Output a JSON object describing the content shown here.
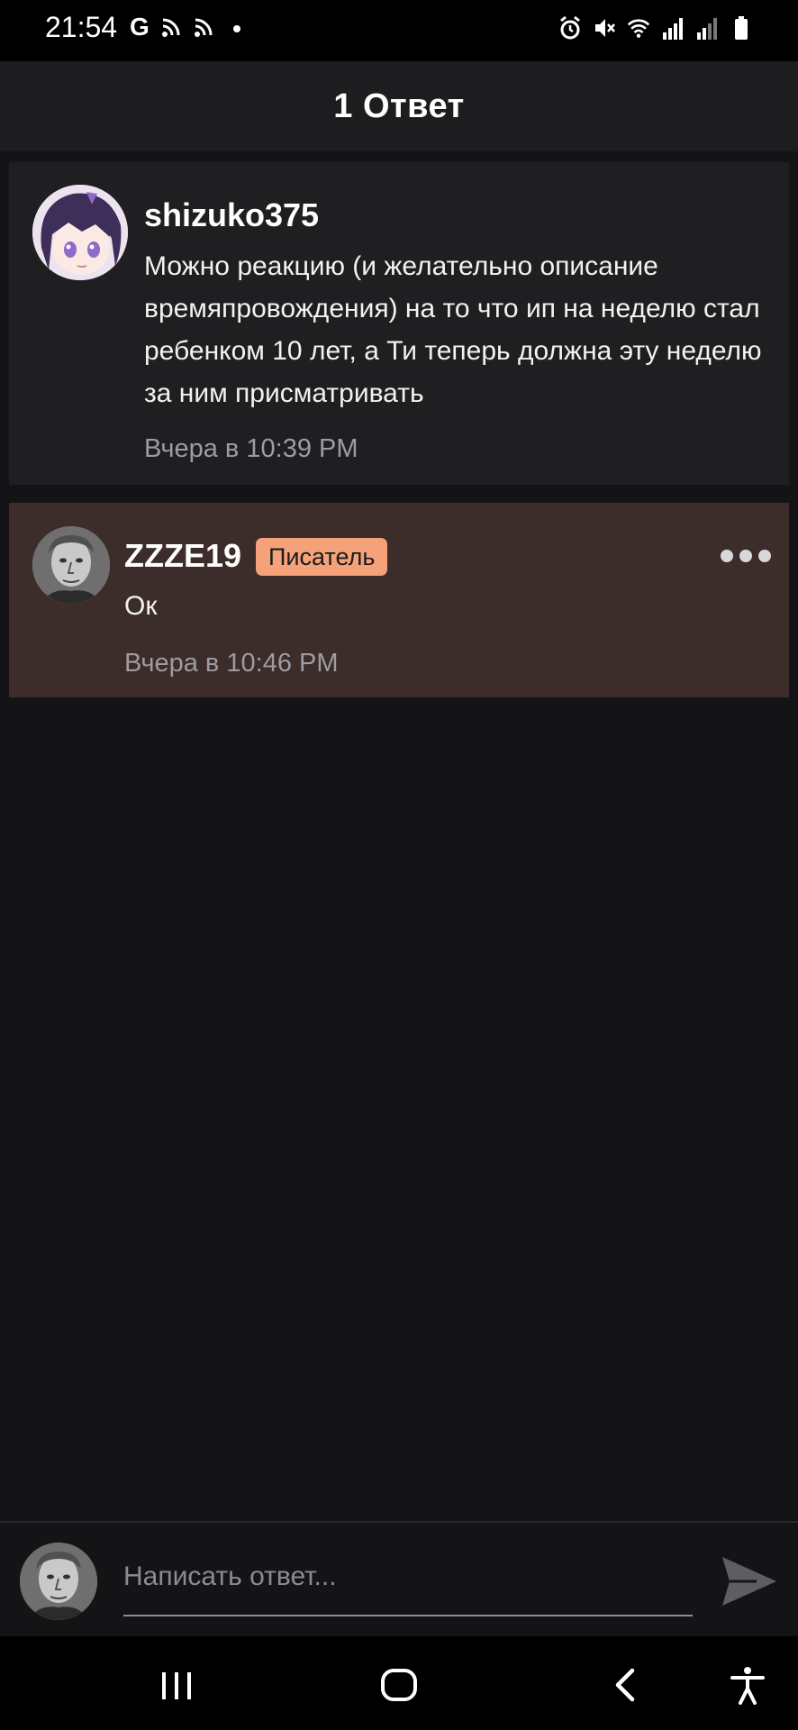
{
  "status_bar": {
    "time": "21:54",
    "left_icons": [
      "google-icon",
      "cast-icon",
      "cast-icon",
      "dot-icon"
    ],
    "right_icons": [
      "alarm-icon",
      "mute-icon",
      "wifi-icon",
      "signal-icon",
      "signal-icon",
      "battery-icon"
    ]
  },
  "header": {
    "title": "1 Ответ"
  },
  "original_comment": {
    "username": "shizuko375",
    "text": "Можно реакцию (и желательно описание времяпровождения) на то что ип на неделю стал ребенком 10 лет, а Ти теперь должна эту неделю за ним присматривать",
    "timestamp": "Вчера в 10:39 PM"
  },
  "reply": {
    "username": "ZZZE19",
    "badge": "Писатель",
    "text": "Ок",
    "timestamp": "Вчера в 10:46 PM",
    "background": "#3c2c2a",
    "badge_color": "#f5a27b"
  },
  "composer": {
    "placeholder": "Написать ответ..."
  },
  "nav": {
    "icons": [
      "recent-apps-icon",
      "home-icon",
      "back-icon",
      "accessibility-icon"
    ]
  }
}
